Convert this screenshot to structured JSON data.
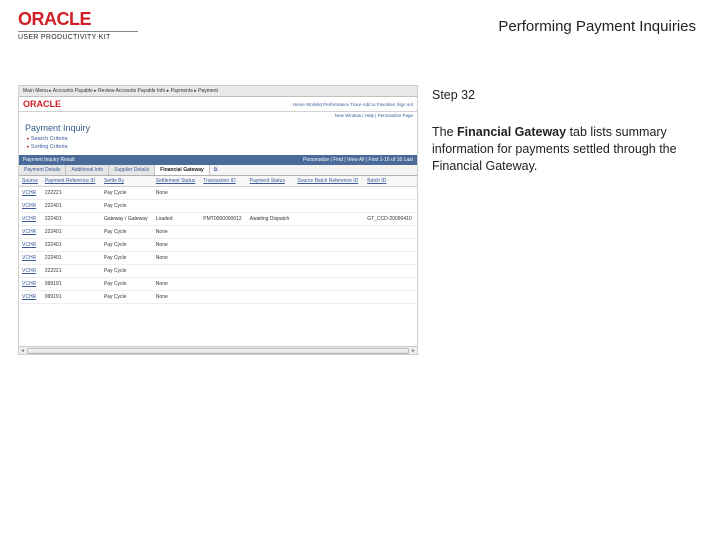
{
  "brand": {
    "name": "ORACLE",
    "product": "USER PRODUCTIVITY KIT"
  },
  "doc_title": "Performing Payment Inquiries",
  "step": {
    "label": "Step 32"
  },
  "instruction": {
    "prefix": "The ",
    "bold": "Financial Gateway",
    "suffix": " tab lists summary information for payments settled through the Financial Gateway."
  },
  "screenshot": {
    "breadcrumb": [
      "Main Menu",
      "Accounts Payable",
      "Review Accounts Payable Info",
      "Payments",
      "Payment"
    ],
    "top_links": [
      "Home",
      "Worklist",
      "Performance Trace",
      "Add to Favorites",
      "Sign out"
    ],
    "util_links": "New Window | Help | Personalize Page",
    "page_title": "Payment Inquiry",
    "sections": [
      "Search Criteria",
      "Sorting Criteria"
    ],
    "grid_title": "Payment Inquiry Result",
    "grid_tools": "Personalize | Find | View All |",
    "grid_range": "First 1-16 of 16 Last",
    "tabs": [
      "Payment Details",
      "Additional Info",
      "Supplier Details",
      "Financial Gateway"
    ],
    "tab_icon": "⧉",
    "columns": [
      "Source",
      "Payment Reference ID",
      "Settle By",
      "Settlement Status",
      "Transaction ID",
      "Payment Status",
      "Source Batch Reference ID",
      "Batch ID"
    ],
    "rows": [
      [
        "VCHR",
        "222221",
        "Pay Cycle",
        "None",
        "",
        "",
        "",
        ""
      ],
      [
        "VCHR",
        "222401",
        "Pay Cycle",
        "",
        "",
        "",
        "",
        ""
      ],
      [
        "VCHR",
        "222401",
        "Gateway / Gateway",
        "Loaded",
        "PMT0000000012",
        "Awaiting Dispatch",
        "",
        "GT_CCD-20090410"
      ],
      [
        "VCHR",
        "222401",
        "Pay Cycle",
        "None",
        "",
        "",
        "",
        ""
      ],
      [
        "VCHR",
        "222401",
        "Pay Cycle",
        "None",
        "",
        "",
        "",
        ""
      ],
      [
        "VCHR",
        "222401",
        "Pay Cycle",
        "None",
        "",
        "",
        "",
        ""
      ],
      [
        "VCHR",
        "222221",
        "Pay Cycle",
        "",
        "",
        "",
        "",
        ""
      ],
      [
        "VCHR",
        "999191",
        "Pay Cycle",
        "None",
        "",
        "",
        "",
        ""
      ],
      [
        "VCHR",
        "999191",
        "Pay Cycle",
        "None",
        "",
        "",
        "",
        ""
      ]
    ]
  }
}
